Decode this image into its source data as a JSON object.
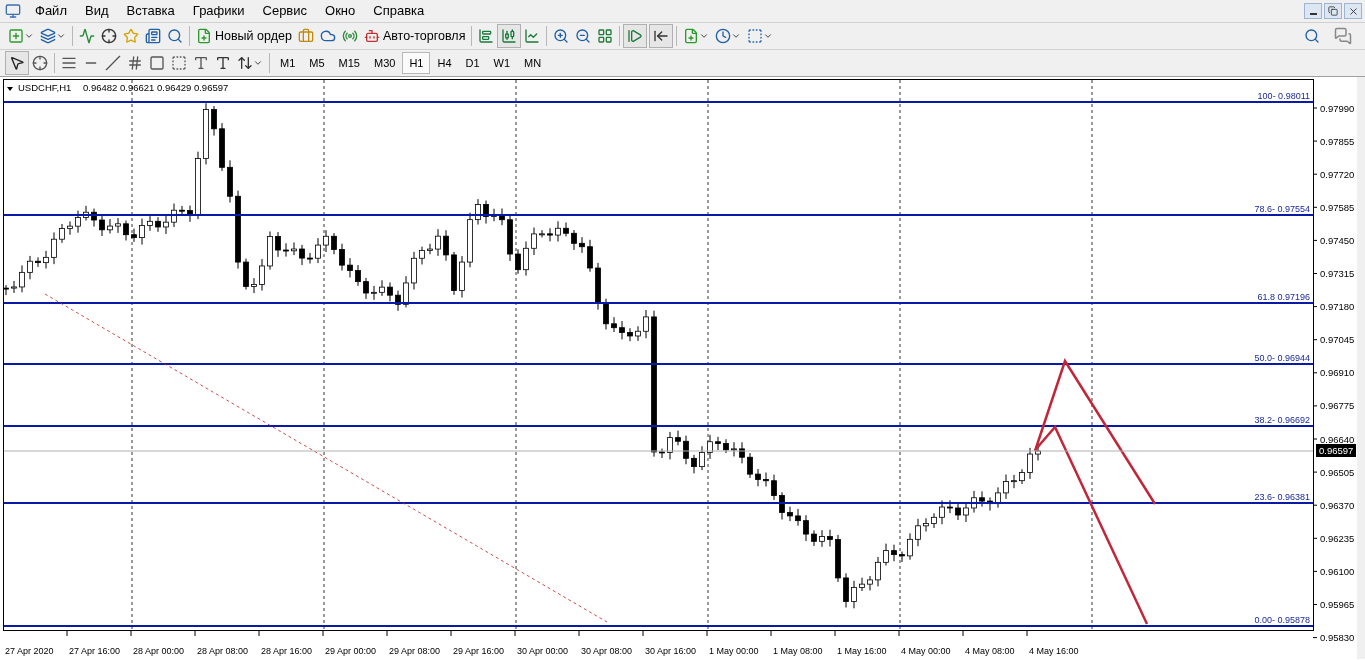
{
  "menu": [
    "Файл",
    "Вид",
    "Вставка",
    "Графики",
    "Сервис",
    "Окно",
    "Справка"
  ],
  "toolbar": {
    "buttons": [
      {
        "label": "Новый ордер"
      },
      {
        "label": "Авто-торговля"
      }
    ]
  },
  "timeframes": [
    {
      "label": "M1",
      "selected": false
    },
    {
      "label": "M5",
      "selected": false
    },
    {
      "label": "M15",
      "selected": false
    },
    {
      "label": "M30",
      "selected": false
    },
    {
      "label": "H1",
      "selected": true
    },
    {
      "label": "H4",
      "selected": false
    },
    {
      "label": "D1",
      "selected": false
    },
    {
      "label": "W1",
      "selected": false
    },
    {
      "label": "MN",
      "selected": false
    }
  ],
  "chart": {
    "symbol": "USDCHF,H1",
    "ohlc": "0.96482 0.96621 0.96429 0.96597",
    "price_ticks": [
      "0.97990",
      "0.97855",
      "0.97720",
      "0.97585",
      "0.97450",
      "0.97315",
      "0.97180",
      "0.97045",
      "0.96910",
      "0.96775",
      "0.96640",
      "0.96505",
      "0.96370",
      "0.96235",
      "0.96100",
      "0.95965",
      "0.95830"
    ],
    "current_price": "0.96597",
    "fib_levels": [
      {
        "label": "100- 0.98011"
      },
      {
        "label": "78.6- 0.97554"
      },
      {
        "label": "61.8 0.97196"
      },
      {
        "label": "50.0- 0.96944"
      },
      {
        "label": "38.2- 0.96692"
      },
      {
        "label": "23.6- 0.96381"
      },
      {
        "label": "0.00- 0.95878"
      }
    ],
    "time_ticks": [
      "27 Apr 2020",
      "27 Apr 16:00",
      "28 Apr 00:00",
      "28 Apr 08:00",
      "28 Apr 16:00",
      "29 Apr 00:00",
      "29 Apr 08:00",
      "29 Apr 16:00",
      "30 Apr 00:00",
      "30 Apr 08:00",
      "30 Apr 16:00",
      "1 May 00:00",
      "1 May 08:00",
      "1 May 16:00",
      "4 May 00:00",
      "4 May 08:00",
      "4 May 16:00"
    ]
  }
}
